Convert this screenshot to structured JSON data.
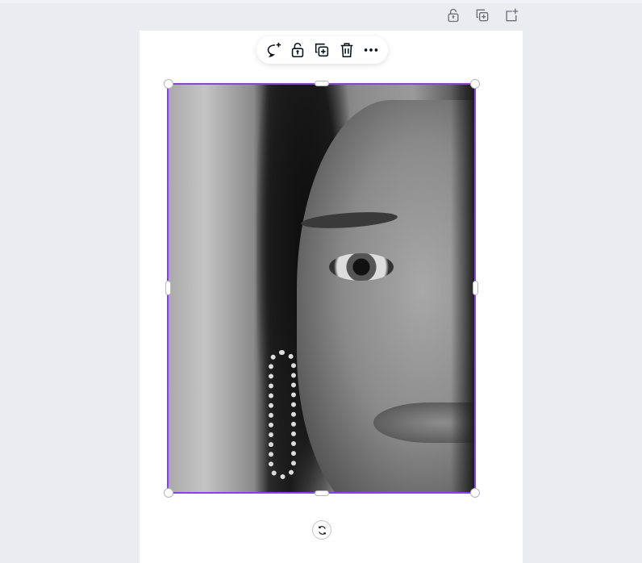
{
  "colors": {
    "selection": "#8b3dff",
    "canvas_bg": "#ebecf0",
    "page_bg": "#ffffff",
    "icon": "#0e1318"
  },
  "page_actions": [
    {
      "icon": "lock-icon"
    },
    {
      "icon": "duplicate-page-icon"
    },
    {
      "icon": "add-page-icon"
    }
  ],
  "element_toolbar": [
    {
      "icon": "comment-add-icon"
    },
    {
      "icon": "lock-icon"
    },
    {
      "icon": "duplicate-icon"
    },
    {
      "icon": "trash-icon"
    },
    {
      "icon": "more-icon"
    }
  ],
  "selected_element": {
    "type": "image",
    "description_icon": "photo"
  },
  "rotate_handle": {
    "icon": "rotate-icon"
  }
}
